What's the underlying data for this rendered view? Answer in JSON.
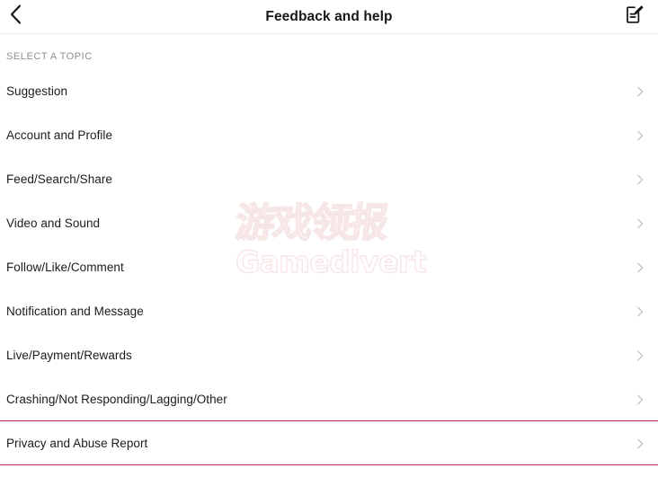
{
  "header": {
    "back_icon": "chevron-left-icon",
    "title": "Feedback and help",
    "compose_icon": "compose-edit-icon"
  },
  "section": {
    "label": "SELECT A TOPIC"
  },
  "topics": [
    {
      "label": "Suggestion",
      "chevron": "chevron-right-icon"
    },
    {
      "label": "Account and Profile",
      "chevron": "chevron-right-icon"
    },
    {
      "label": "Feed/Search/Share",
      "chevron": "chevron-right-icon"
    },
    {
      "label": "Video and Sound",
      "chevron": "chevron-right-icon"
    },
    {
      "label": "Follow/Like/Comment",
      "chevron": "chevron-right-icon"
    },
    {
      "label": "Notification and Message",
      "chevron": "chevron-right-icon"
    },
    {
      "label": "Live/Payment/Rewards",
      "chevron": "chevron-right-icon"
    },
    {
      "label": "Crashing/Not Responding/Lagging/Other",
      "chevron": "chevron-right-icon"
    },
    {
      "label": "Privacy and Abuse Report",
      "chevron": "chevron-right-icon"
    }
  ],
  "watermark": {
    "line1": "游戏领报",
    "line2": "Gamedivert"
  },
  "colors": {
    "text_primary": "#1b1b1f",
    "text_muted": "#8e8e93",
    "divider_light": "#ececec",
    "divider_accent": "#9e2a46",
    "background": "#ffffff",
    "chevron": "#c7c7cc",
    "watermark": "#f8e7e8"
  }
}
